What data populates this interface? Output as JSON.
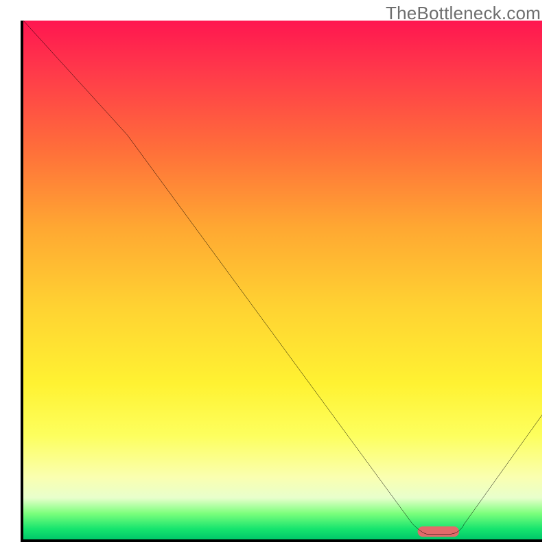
{
  "watermark": "TheBottleneck.com",
  "chart_data": {
    "type": "line",
    "title": "",
    "xlabel": "",
    "ylabel": "",
    "xlim": [
      0,
      100
    ],
    "ylim": [
      0,
      100
    ],
    "series": [
      {
        "name": "curve",
        "x": [
          0,
          20,
          75,
          78,
          82,
          84,
          100
        ],
        "y": [
          100,
          78,
          3,
          1,
          1,
          2,
          24
        ]
      }
    ],
    "marker": {
      "name": "optimal-region",
      "x_center": 80,
      "y": 1,
      "width": 8,
      "color": "#e36a6a"
    },
    "gradient_stops": [
      {
        "pos": 0,
        "color": "#ff1650"
      },
      {
        "pos": 25,
        "color": "#ff6f3a"
      },
      {
        "pos": 55,
        "color": "#ffd232"
      },
      {
        "pos": 80,
        "color": "#fdff5e"
      },
      {
        "pos": 95,
        "color": "#7cff7c"
      },
      {
        "pos": 100,
        "color": "#00c86a"
      }
    ]
  }
}
